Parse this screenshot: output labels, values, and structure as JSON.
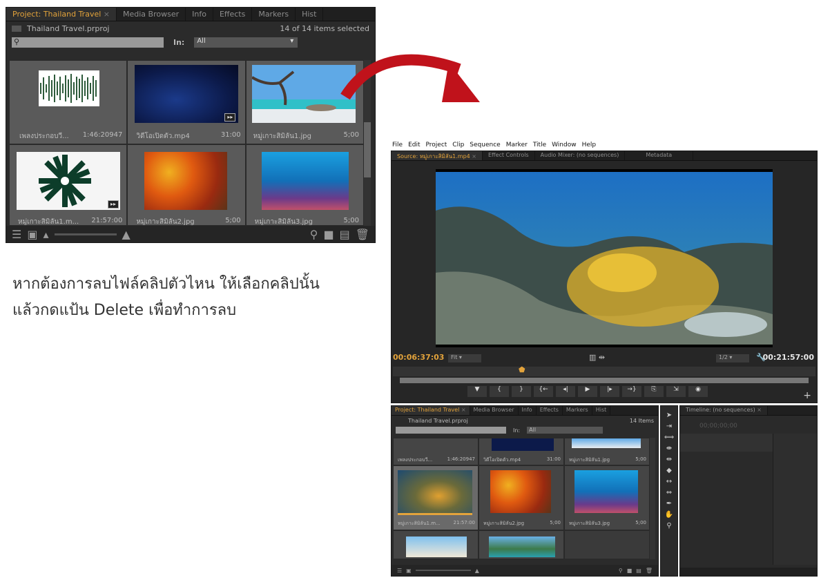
{
  "top_panel": {
    "tabs": [
      "Project: Thailand Travel",
      "Media Browser",
      "Info",
      "Effects",
      "Markers",
      "Hist"
    ],
    "project_file": "Thailand Travel.prproj",
    "selection_status": "14 of 14 items selected",
    "search_placeholder": "",
    "in_label": "In:",
    "in_value": "All",
    "items": [
      {
        "name": "เพลงประกอบวี...",
        "duration": "1:46:20947"
      },
      {
        "name": "วิดีโอเปิดตัว.mp4",
        "duration": "31:00"
      },
      {
        "name": "หมู่เกาะสิมิลัน1.jpg",
        "duration": "5;00"
      },
      {
        "name": "หมู่เกาะสิมิลัน1.m...",
        "duration": "21:57:00"
      },
      {
        "name": "หมู่เกาะสิมิลัน2.jpg",
        "duration": "5;00"
      },
      {
        "name": "หมู่เกาะสิมิลัน3.jpg",
        "duration": "5;00"
      }
    ]
  },
  "instruction": {
    "line1": "หากต้องการลบไฟล์คลิปตัวไหน ให้เลือกคลิปนั้น",
    "line2": "แล้วกดแป้น Delete เพื่อทำการลบ"
  },
  "app": {
    "menu": [
      "File",
      "Edit",
      "Project",
      "Clip",
      "Sequence",
      "Marker",
      "Title",
      "Window",
      "Help"
    ],
    "source_tabs": [
      "Source: หมู่เกาะสิมิลัน1.mp4",
      "Effect Controls",
      "Audio Mixer: (no sequences)",
      "Metadata"
    ],
    "current_time": "00:06:37:03",
    "fit": "Fit",
    "resolution": "1/2",
    "duration": "00:21:57:00",
    "bottom_tabs": [
      "Project: Thailand Travel",
      "Media Browser",
      "Info",
      "Effects",
      "Markers",
      "Hist"
    ],
    "project_file": "Thailand Travel.prproj",
    "items_count": "14 Items",
    "in_label": "In:",
    "in_value": "All",
    "items": [
      {
        "name": "เพลงประกอบวี...",
        "duration": "1:46:20947"
      },
      {
        "name": "วิดีโอเปิดตัว.mp4",
        "duration": "31:00"
      },
      {
        "name": "หมู่เกาะสิมิลัน1.jpg",
        "duration": "5;00"
      },
      {
        "name": "หมู่เกาะสิมิลัน1.m...",
        "duration": "21:57:00"
      },
      {
        "name": "หมู่เกาะสิมิลัน2.jpg",
        "duration": "5;00"
      },
      {
        "name": "หมู่เกาะสิมิลัน3.jpg",
        "duration": "5;00"
      }
    ],
    "timeline_tab": "Timeline: (no sequences)",
    "timeline_time": "00;00;00;00"
  },
  "colors": {
    "accent": "#e3a33b",
    "arrow": "#c0121b",
    "panel": "#2b2b2b"
  }
}
